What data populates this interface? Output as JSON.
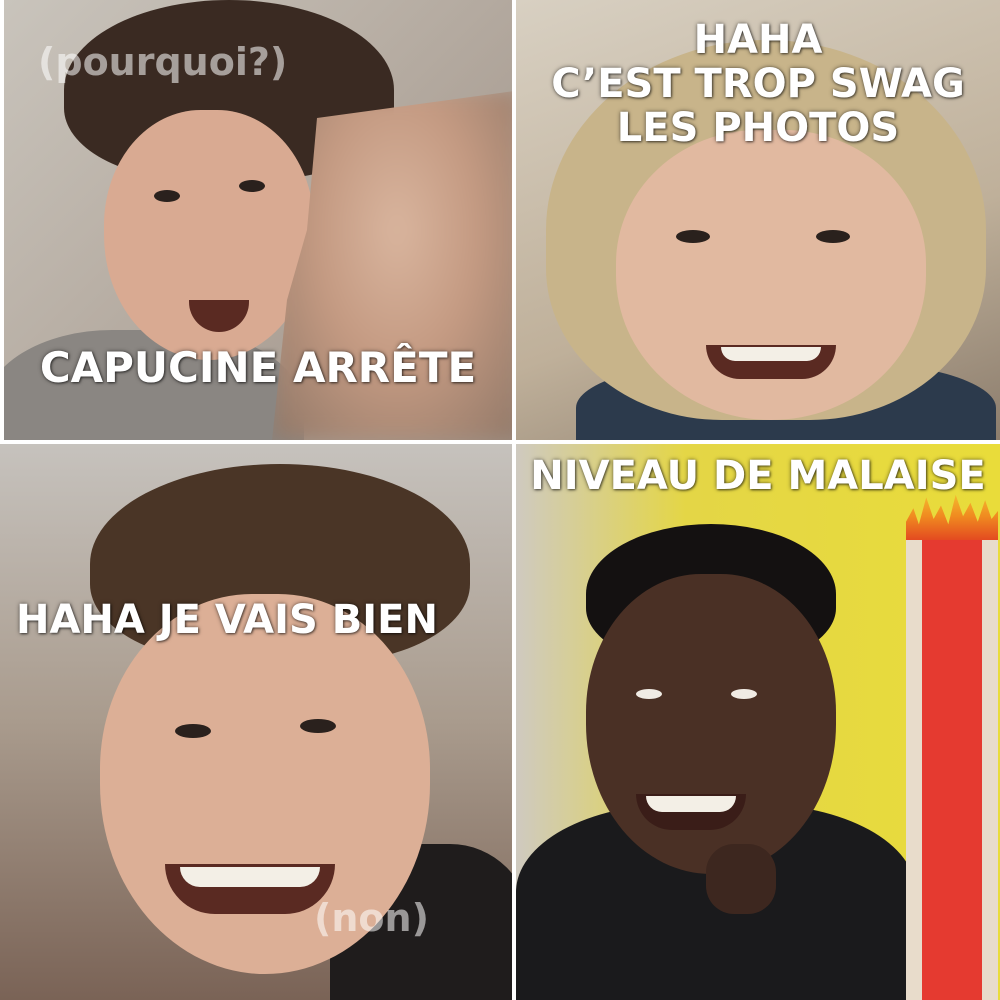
{
  "captions": {
    "top_left": "CAPUCINE ARRÊTE",
    "top_left_aside": "(pourquoi?)",
    "top_right_line1": "HAHA",
    "top_right_line2": "C’EST TROP SWAG",
    "top_right_line3": "LES PHOTOS",
    "bottom_left": "HAHA JE VAIS BIEN",
    "bottom_left_aside": "(non)",
    "bottom_right": "NIVEAU DE MALAISE"
  },
  "malaise_level": 1.0,
  "colors": {
    "caption_text": "#ffffff",
    "malaise_bar": "#e53a30",
    "background_yellow": "#e9dc3a"
  }
}
